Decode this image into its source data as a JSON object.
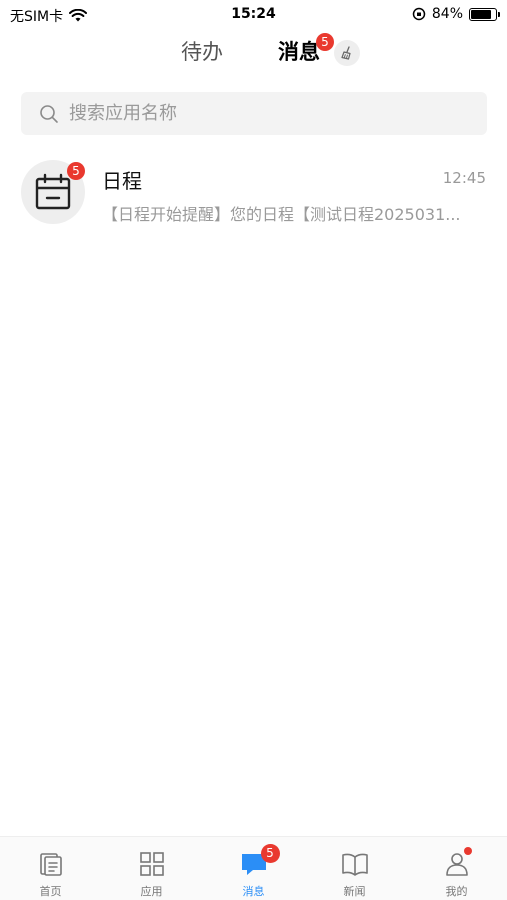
{
  "status_bar": {
    "carrier": "无SIM卡",
    "time": "15:24",
    "battery": "84%",
    "battery_level": 0.84
  },
  "top_tabs": {
    "todo": "待办",
    "messages": "消息",
    "messages_badge": "5"
  },
  "search": {
    "placeholder": "搜索应用名称"
  },
  "messages": [
    {
      "title": "日程",
      "time": "12:45",
      "preview": "【日程开始提醒】您的日程【测试日程2025031...",
      "badge": "5",
      "icon": "calendar-icon"
    }
  ],
  "bottom_nav": {
    "home": "首页",
    "apps": "应用",
    "messages": "消息",
    "messages_badge": "5",
    "news": "新闻",
    "mine": "我的",
    "active": "messages"
  },
  "colors": {
    "accent": "#2b8ef6",
    "badge": "#e9392f"
  }
}
